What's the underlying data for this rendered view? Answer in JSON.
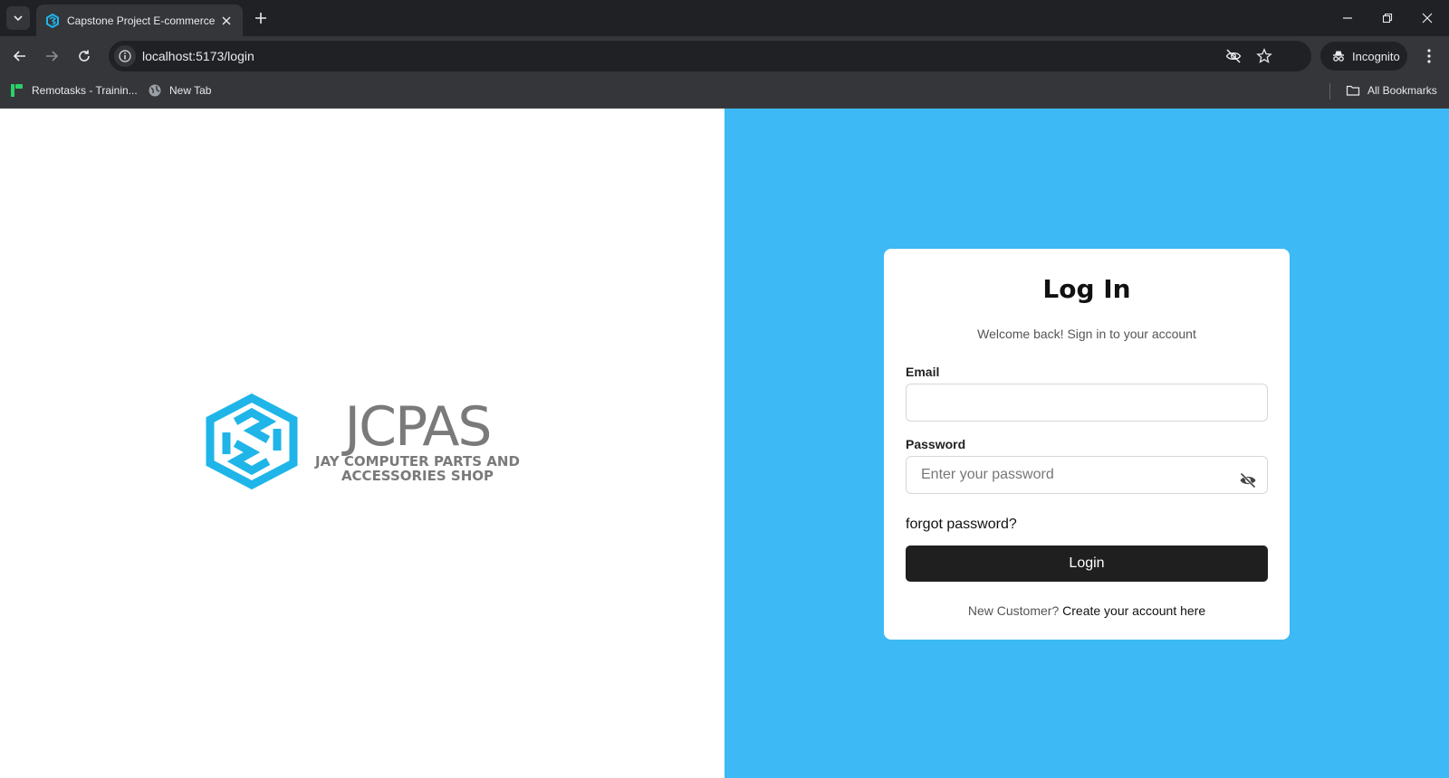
{
  "browser": {
    "tab_title": "Capstone Project E-commerce",
    "url": "localhost:5173/login",
    "incognito_label": "Incognito",
    "bookmarks": [
      {
        "label": "Remotasks - Trainin..."
      },
      {
        "label": "New Tab"
      }
    ],
    "all_bookmarks_label": "All Bookmarks"
  },
  "brand": {
    "name": "JCPAS",
    "tagline_line1": "JAY COMPUTER PARTS AND",
    "tagline_line2": "ACCESSORIES SHOP",
    "logo_color": "#1fb5e8"
  },
  "login": {
    "title": "Log In",
    "subtitle": "Welcome back! Sign in to your account",
    "email_label": "Email",
    "email_value": "",
    "password_label": "Password",
    "password_placeholder": "Enter your password",
    "forgot_label": "forgot password?",
    "login_button": "Login",
    "new_customer_text": "New Customer?",
    "create_account_link": "Create your account here"
  },
  "colors": {
    "panel_bg": "#3db9f5",
    "button_bg": "#1f1f1f"
  }
}
